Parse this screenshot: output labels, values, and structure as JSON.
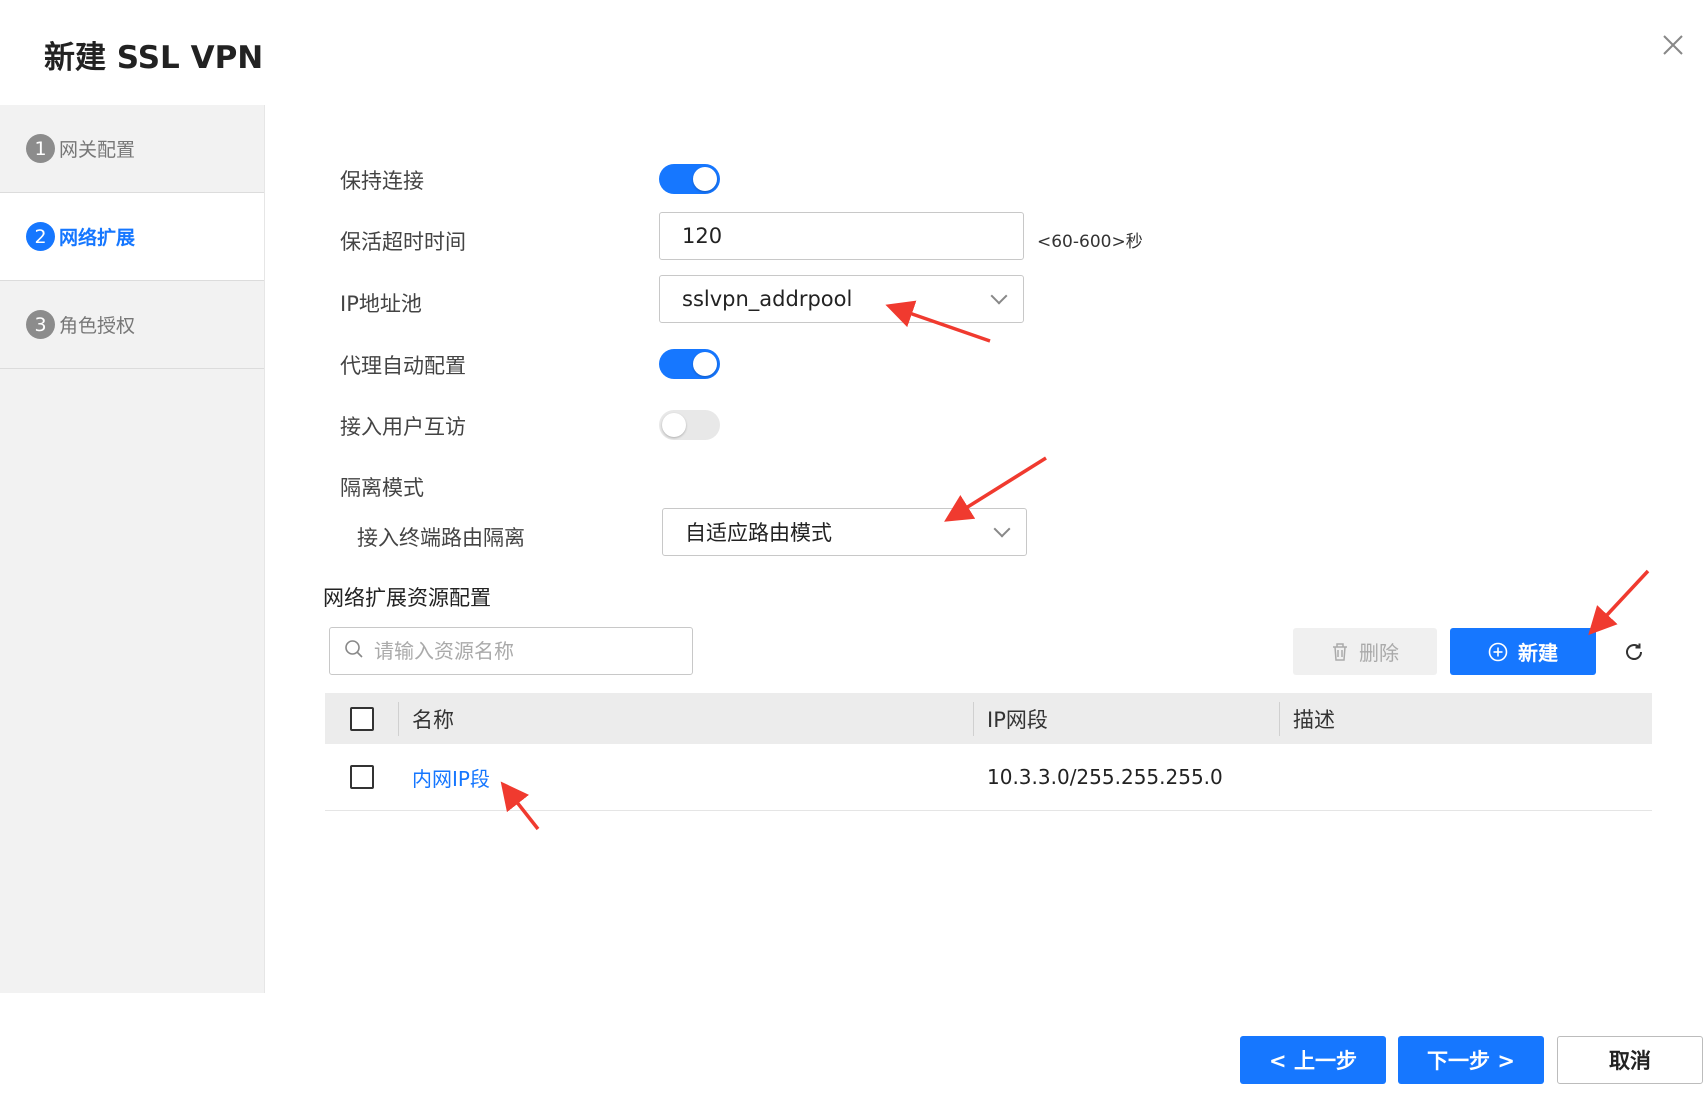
{
  "dialog": {
    "title": "新建 SSL VPN"
  },
  "steps": [
    {
      "num": "1",
      "label": "网关配置"
    },
    {
      "num": "2",
      "label": "网络扩展"
    },
    {
      "num": "3",
      "label": "角色授权"
    }
  ],
  "form": {
    "keep_alive": {
      "label": "保持连接",
      "enabled": true
    },
    "keepalive_timeout": {
      "label": "保活超时时间",
      "value": "120",
      "hint": "<60-600>秒"
    },
    "ip_pool": {
      "label": "IP地址池",
      "value": "sslvpn_addrpool"
    },
    "proxy_auto_config": {
      "label": "代理自动配置",
      "enabled": true
    },
    "user_mutual_access": {
      "label": "接入用户互访",
      "enabled": false
    },
    "isolation_mode": {
      "label": "隔离模式"
    },
    "terminal_route_isolation": {
      "label": "接入终端路由隔离",
      "value": "自适应路由模式"
    }
  },
  "resources": {
    "title": "网络扩展资源配置",
    "search_placeholder": "请输入资源名称",
    "delete_label": "删除",
    "new_label": "新建",
    "columns": [
      "名称",
      "IP网段",
      "描述"
    ],
    "rows": [
      {
        "name": "内网IP段",
        "ip_segment": "10.3.3.0/255.255.255.0",
        "description": ""
      }
    ]
  },
  "footer": {
    "prev": "< 上一步",
    "next": "下一步 >",
    "cancel": "取消"
  },
  "colors": {
    "primary": "#1677ff",
    "annotation_arrow": "#f03a2f"
  }
}
